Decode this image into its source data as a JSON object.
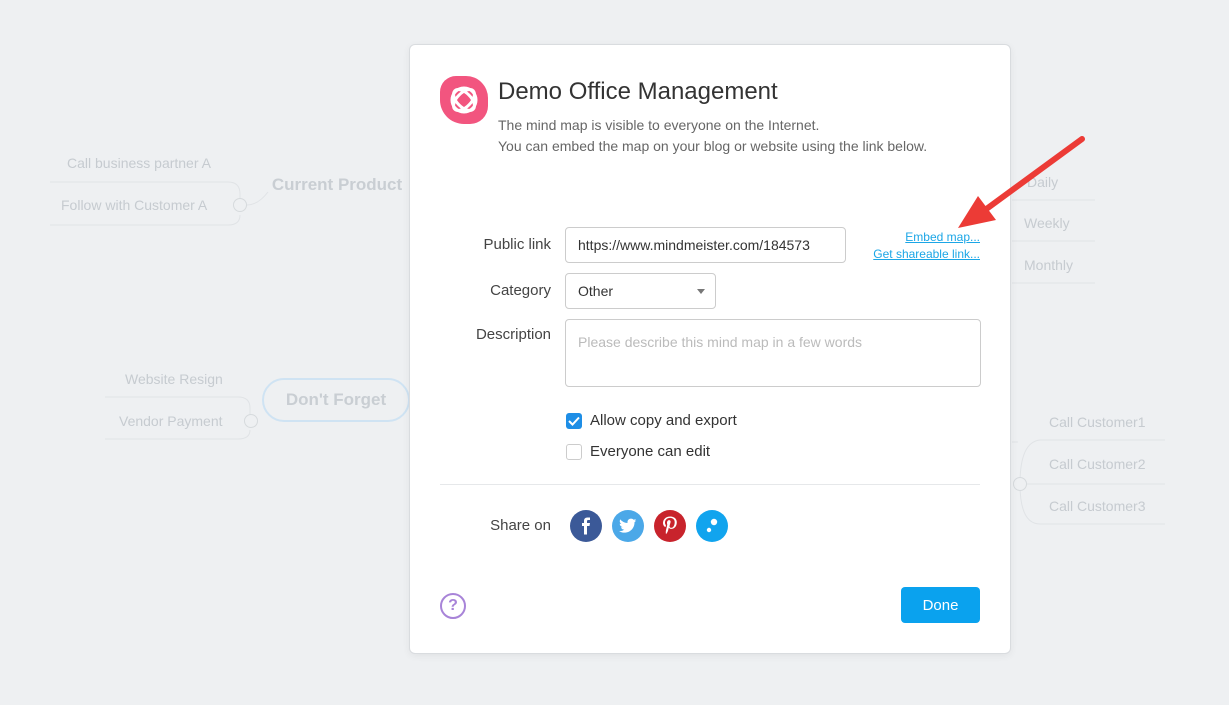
{
  "background": {
    "left_top": {
      "node": "Current Product",
      "children": [
        "Call business partner A",
        "Follow with Customer A"
      ]
    },
    "left_bottom": {
      "node": "Don't Forget",
      "children": [
        "Website Resign",
        "Vendor Payment"
      ]
    },
    "right_top": {
      "children": [
        "Daily",
        "Weekly",
        "Monthly"
      ]
    },
    "right_bottom": {
      "children": [
        "Call Customer1",
        "Call Customer2",
        "Call Customer3"
      ]
    }
  },
  "dialog": {
    "title": "Demo Office Management",
    "subtitle_line1": "The mind map is visible to everyone on the Internet.",
    "subtitle_line2": "You can embed the map on your blog or website using the link below.",
    "public_link_label": "Public link",
    "public_link_value": "https://www.mindmeister.com/184573",
    "embed_link": "Embed map...",
    "shareable_link": "Get shareable link...",
    "category_label": "Category",
    "category_value": "Other",
    "description_label": "Description",
    "description_placeholder": "Please describe this mind map in a few words",
    "allow_copy_label": "Allow copy and export",
    "allow_copy_checked": true,
    "everyone_edit_label": "Everyone can edit",
    "everyone_edit_checked": false,
    "share_on_label": "Share on",
    "social": [
      {
        "name": "facebook-icon",
        "glyph": "f",
        "color": "#3b5998"
      },
      {
        "name": "twitter-icon",
        "glyph": "t",
        "color": "#4ba8e8"
      },
      {
        "name": "pinterest-icon",
        "glyph": "p",
        "color": "#c8232c"
      },
      {
        "name": "mindmeister-share-icon",
        "glyph": "m",
        "color": "#11a4ee"
      }
    ],
    "help_glyph": "?",
    "done_label": "Done"
  },
  "colors": {
    "accent": "#0aa2ee",
    "link": "#1ba6e6",
    "logo": "#f2557f",
    "arrow": "#ec3b36"
  }
}
